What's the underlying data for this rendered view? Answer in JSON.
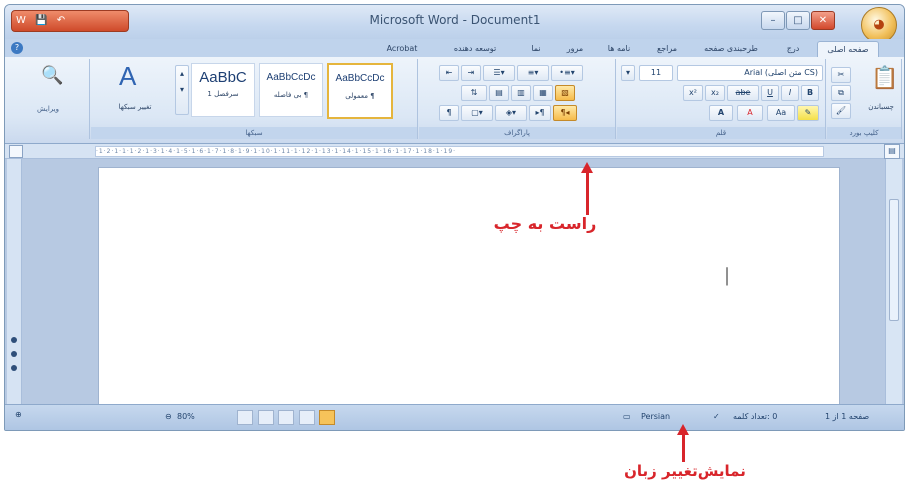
{
  "window": {
    "title": "Microsoft Word - Document1",
    "controls": {
      "minimize": "–",
      "maximize": "□",
      "close": "✕"
    }
  },
  "qat": {
    "icons": [
      "W",
      "💾",
      "↶"
    ]
  },
  "tabs": [
    {
      "label": "صفحه اصلی",
      "active": true
    },
    {
      "label": "درج"
    },
    {
      "label": "طرحبندی صفحه"
    },
    {
      "label": "مراجع"
    },
    {
      "label": "نامه ها"
    },
    {
      "label": "مرور"
    },
    {
      "label": "نما"
    },
    {
      "label": "توسعه دهنده"
    },
    {
      "label": "Acrobat"
    }
  ],
  "ribbon": {
    "clipboard": {
      "label": "کلیپ بورد",
      "paste": "چسباندن"
    },
    "font": {
      "label": "قلم",
      "font_name": "Arial (متن اصلی CS)",
      "font_size": "11",
      "buttons": [
        "B",
        "I",
        "U",
        "abe",
        "x₂",
        "x²",
        "Aa",
        "A",
        "A"
      ]
    },
    "paragraph": {
      "label": "پاراگراف",
      "rtl_button": "¶◂",
      "ltr_button": "▸¶"
    },
    "styles": {
      "label": "سبکها",
      "items": [
        {
          "sample": "AaBbCcDc",
          "name": "¶ معمولی",
          "selected": true
        },
        {
          "sample": "AaBbCcDc",
          "name": "¶ بی فاصله"
        },
        {
          "sample": "AaBbC",
          "name": "سرفصل 1",
          "big": true
        }
      ],
      "change_styles": "تغییر سبکها"
    },
    "editing": {
      "label": "ویرایش"
    }
  },
  "ruler": {
    "marks": "·1·2·1·1·1·2·1·3·1·4·1·5·1·6·1·7·1·8·1·9·1·10·1·11·1·12·1·13·1·14·1·15·1·16·1·17·1·18·1·19·"
  },
  "document": {
    "text": "|"
  },
  "statusbar": {
    "page": "صفحه 1 از 1",
    "words": "0 :تعداد کلمه",
    "language": "Persian",
    "zoom": "80%"
  },
  "annotations": {
    "rtl_label": "راست به چپ",
    "language_label": "نمایش‌تغییر زبان"
  },
  "colors": {
    "annotation": "#d8252b",
    "accent": "#f6c35a"
  }
}
